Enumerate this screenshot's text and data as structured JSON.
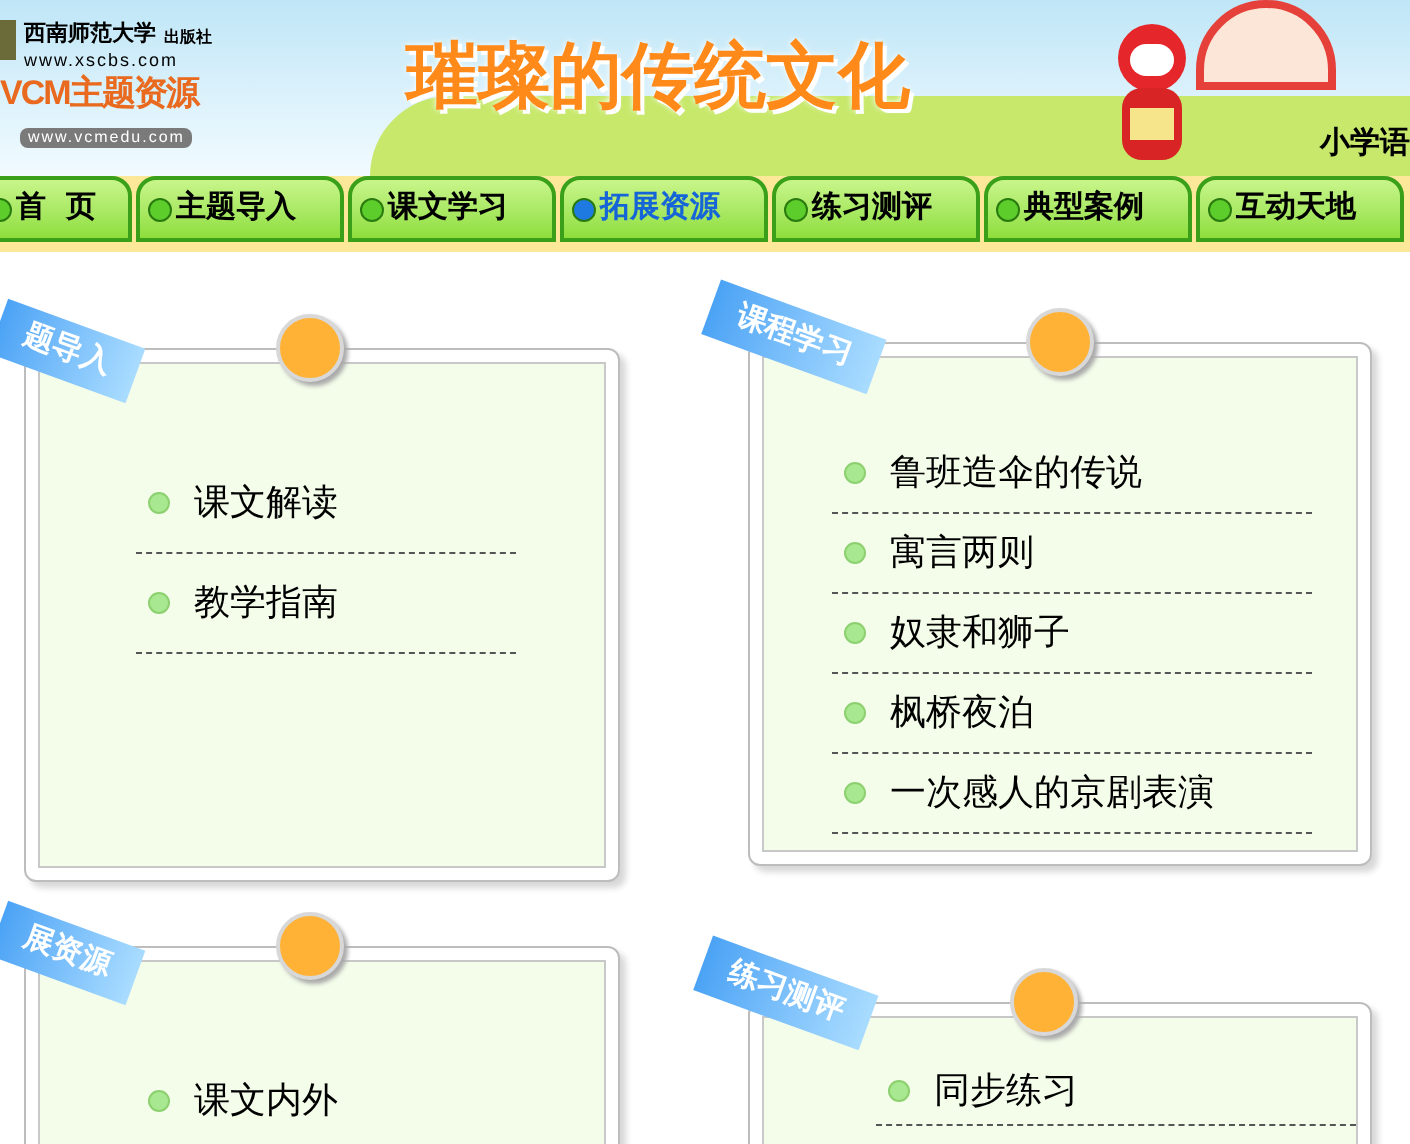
{
  "header": {
    "publisher": "西南师范大学",
    "publisher_suffix": "出版社",
    "publisher_url": "www.xscbs.com",
    "brand": "VCM主题资源",
    "brand_url": "www.vcmedu.com",
    "title": "璀璨的传统文化",
    "corner_text": "小学语"
  },
  "nav": {
    "tabs": [
      {
        "label": "首页",
        "selected": false
      },
      {
        "label": "主题导入",
        "selected": false
      },
      {
        "label": "课文学习",
        "selected": false
      },
      {
        "label": "拓展资源",
        "selected": true
      },
      {
        "label": "练习测评",
        "selected": false
      },
      {
        "label": "典型案例",
        "selected": false
      },
      {
        "label": "互动天地",
        "selected": false
      }
    ]
  },
  "cards": [
    {
      "ribbon": "题导入",
      "items": [
        "课文解读",
        "教学指南"
      ]
    },
    {
      "ribbon": "课程学习",
      "items": [
        "鲁班造伞的传说",
        "寓言两则",
        "奴隶和狮子",
        "枫桥夜泊",
        "一次感人的京剧表演"
      ]
    },
    {
      "ribbon": "展资源",
      "items": [
        "课文内外"
      ]
    },
    {
      "ribbon": "练习测评",
      "items": [
        "同步练习"
      ]
    }
  ]
}
